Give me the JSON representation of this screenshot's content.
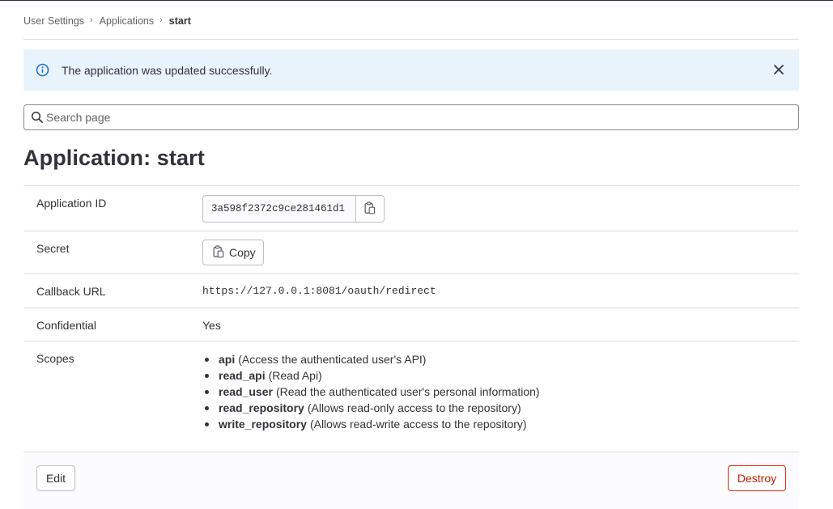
{
  "breadcrumb": {
    "items": [
      "User Settings",
      "Applications"
    ],
    "current": "start"
  },
  "alert": {
    "message": "The application was updated successfully.",
    "icon": "info-icon",
    "close_icon": "close-icon",
    "background": "#e9f3fc",
    "icon_color": "#1f75cb"
  },
  "search": {
    "placeholder": "Search page",
    "value": ""
  },
  "page": {
    "title": "Application: start"
  },
  "details": {
    "application_id": {
      "label": "Application ID",
      "value": "3a598f2372c9ce281461d1",
      "copy_icon": "clipboard-icon"
    },
    "secret": {
      "label": "Secret",
      "copy_label": "Copy",
      "copy_icon": "clipboard-icon"
    },
    "callback": {
      "label": "Callback URL",
      "value": "https://127.0.0.1:8081/oauth/redirect"
    },
    "confidential": {
      "label": "Confidential",
      "value": "Yes"
    },
    "scopes": {
      "label": "Scopes",
      "items": [
        {
          "name": "api",
          "desc": "(Access the authenticated user's API)"
        },
        {
          "name": "read_api",
          "desc": "(Read Api)"
        },
        {
          "name": "read_user",
          "desc": "(Read the authenticated user's personal information)"
        },
        {
          "name": "read_repository",
          "desc": "(Allows read-only access to the repository)"
        },
        {
          "name": "write_repository",
          "desc": "(Allows read-write access to the repository)"
        }
      ]
    }
  },
  "footer": {
    "edit_label": "Edit",
    "destroy_label": "Destroy",
    "destroy_color": "#dd2b0e"
  }
}
